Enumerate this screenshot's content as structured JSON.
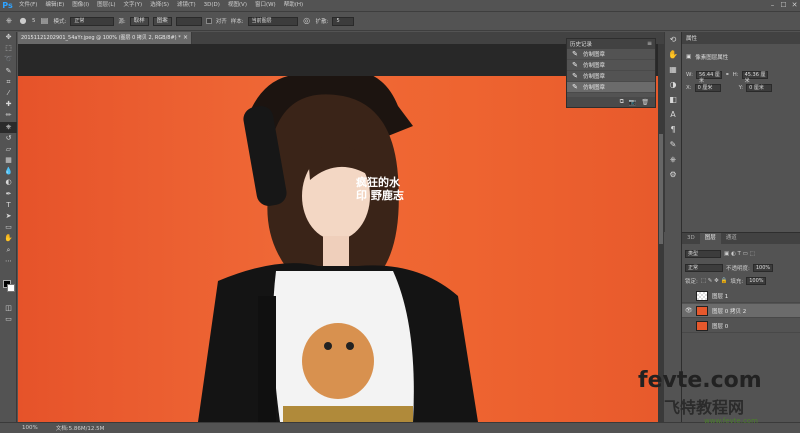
{
  "app": {
    "logo": "Ps"
  },
  "menubar": {
    "items": [
      "文件(F)",
      "编辑(E)",
      "图像(I)",
      "图层(L)",
      "文字(Y)",
      "选择(S)",
      "滤镜(T)",
      "3D(D)",
      "视图(V)",
      "窗口(W)",
      "帮助(H)"
    ],
    "window_controls": [
      "–",
      "☐",
      "✕"
    ]
  },
  "options_bar": {
    "brush_size": "5",
    "mode_label": "模式:",
    "mode_value": "正常",
    "source_label": "源:",
    "source_btn_sampled": "取样",
    "source_btn_pattern": "图案",
    "aligned_label": "对齐",
    "sample_label": "样本:",
    "sample_value": "当前图层",
    "diffusion_label": "扩散:",
    "diffusion_value": "5"
  },
  "document": {
    "tab_title": "20151121202901_54aYr.jpeg @ 100% (图层 0 拷贝 2, RGB/8#) *",
    "close": "×",
    "watermark_text": "疯狂的水印 野鹿志"
  },
  "history": {
    "title": "历史记录",
    "menu": "≡",
    "items": [
      "仿制图章",
      "仿制图章",
      "仿制图章",
      "仿制图章"
    ],
    "selected_index": 3
  },
  "properties": {
    "title": "属性",
    "subtitle": "像素图层属性",
    "w_label": "W:",
    "w_value": "56.44 厘米",
    "h_label": "H:",
    "h_value": "45.36 厘米",
    "x_label": "X:",
    "x_value": "0 厘米",
    "y_label": "Y:",
    "y_value": "0 厘米",
    "link": "⚭"
  },
  "layers_panel": {
    "tabs": [
      "3D",
      "图层",
      "通道"
    ],
    "active_tab": 1,
    "kind_filter": "类型",
    "blend_mode": "正常",
    "opacity_label": "不透明度:",
    "opacity_value": "100%",
    "lock_label": "锁定:",
    "fill_label": "填充:",
    "fill_value": "100%",
    "layers": [
      {
        "name": "图层 1",
        "visible": false,
        "selected": false,
        "thumb": "transparent"
      },
      {
        "name": "图层 0 拷贝 2",
        "visible": true,
        "selected": true,
        "thumb": "photo"
      },
      {
        "name": "图层 0",
        "visible": false,
        "selected": false,
        "thumb": "photo"
      }
    ]
  },
  "status_bar": {
    "zoom": "100%",
    "doc_info": "文档:5.86M/12.5M"
  },
  "site_watermark": {
    "main": "fevte.com",
    "sub": "飞特教程网",
    "url": "www.fevte.com"
  },
  "colors": {
    "ui_gray": "#535353",
    "canvas_bg": "#282828",
    "photo_orange": "#ee6430",
    "ps_blue": "#2fa3ff"
  }
}
